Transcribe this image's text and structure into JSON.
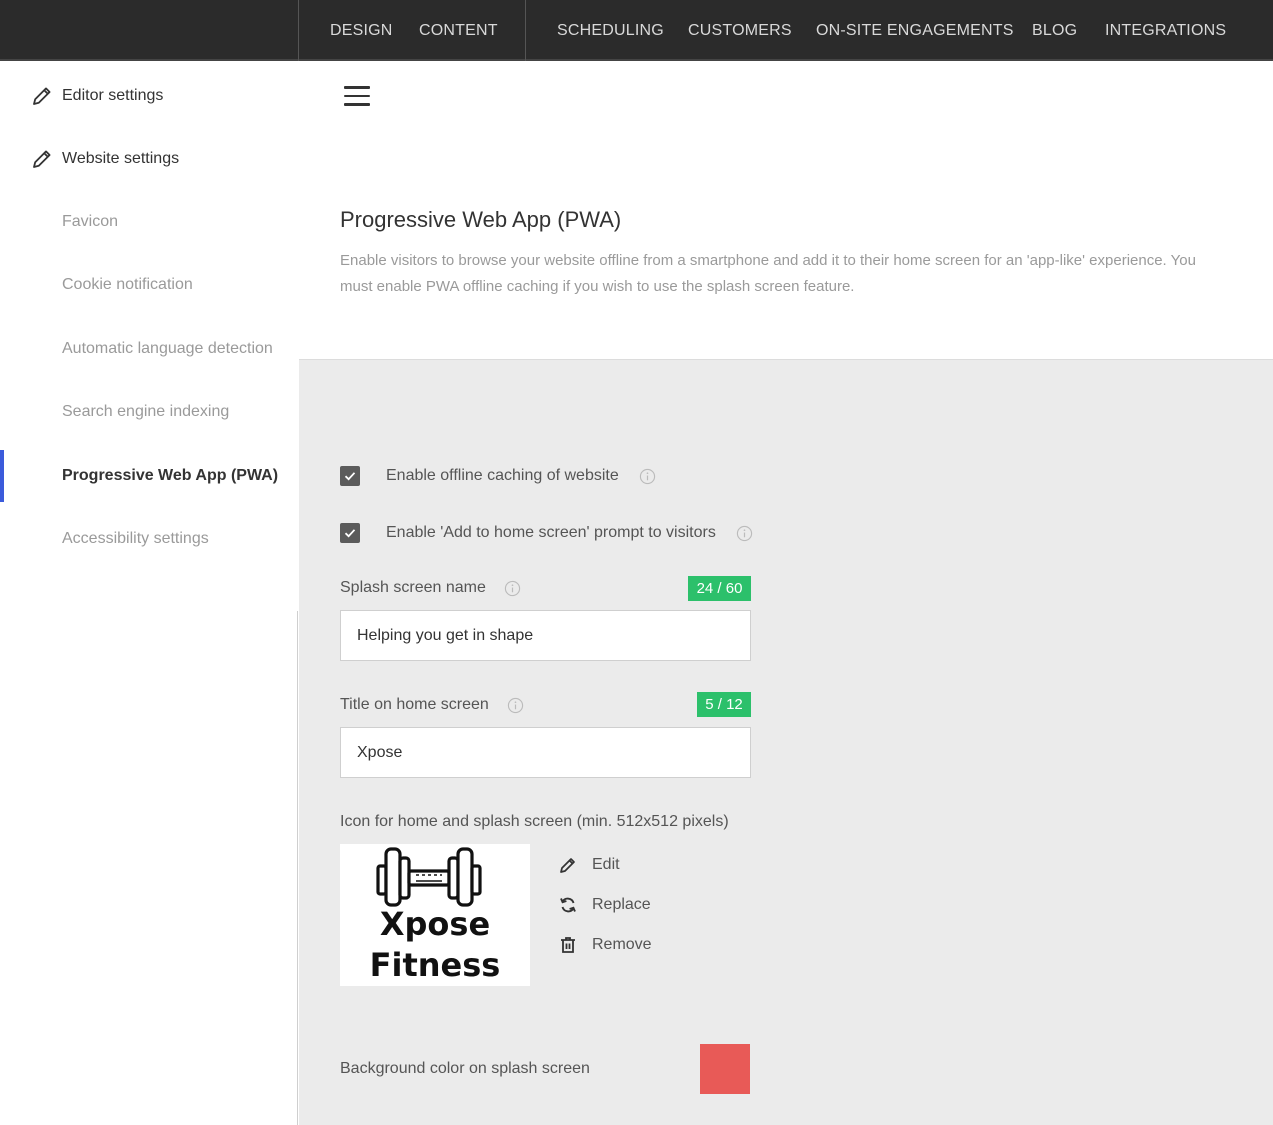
{
  "topnav": {
    "items": [
      "DESIGN",
      "CONTENT",
      "SCHEDULING",
      "CUSTOMERS",
      "ON-SITE ENGAGEMENTS",
      "BLOG",
      "INTEGRATIONS"
    ]
  },
  "sidebar": {
    "headers": [
      "Editor settings",
      "Website settings"
    ],
    "items": [
      "Favicon",
      "Cookie notification",
      "Automatic language detection",
      "Search engine indexing",
      "Progressive Web App (PWA)",
      "Accessibility settings"
    ],
    "active_index": 4
  },
  "page": {
    "title": "Progressive Web App (PWA)",
    "description": "Enable visitors to browse your website offline from a smartphone and add it to their home screen for an 'app-like' experience. You must enable PWA offline caching if you wish to use the splash screen feature."
  },
  "settings": {
    "offline_caching": {
      "label": "Enable offline caching of website",
      "checked": true
    },
    "home_prompt": {
      "label": "Enable 'Add to home screen' prompt to visitors",
      "checked": true
    },
    "splash_name": {
      "label": "Splash screen name",
      "counter": "24 / 60",
      "value": "Helping you get in shape"
    },
    "home_title": {
      "label": "Title on home screen",
      "counter": "5 / 12",
      "value": "Xpose"
    },
    "icon": {
      "label": "Icon for home and splash screen (min. 512x512 pixels)",
      "logo_text_line1": "Xpose",
      "logo_text_line2": "Fitness",
      "actions": [
        "Edit",
        "Replace",
        "Remove"
      ]
    },
    "background_color": {
      "label": "Background color on splash screen",
      "value": "#e85a57"
    }
  },
  "colors": {
    "topbar": "#2b2b2b",
    "accent": "#3b5bdb",
    "counter_badge": "#2cc06b"
  }
}
